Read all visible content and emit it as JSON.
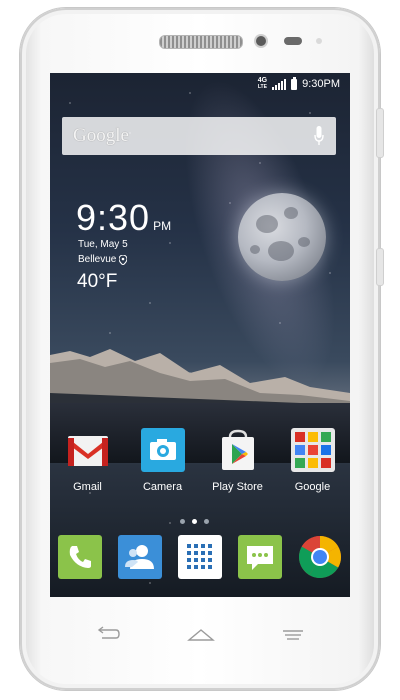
{
  "statusbar": {
    "network": "4G",
    "network_sub": "LTE",
    "time": "9:30PM"
  },
  "search": {
    "logo": "Google",
    "mic_icon": "mic-icon"
  },
  "clock": {
    "time": "9:30",
    "ampm": "PM",
    "date": "Tue, May 5",
    "location": "Bellevue",
    "temperature": "40°F"
  },
  "apps": [
    {
      "label": "Gmail",
      "icon": "gmail-icon"
    },
    {
      "label": "Camera",
      "icon": "camera-icon"
    },
    {
      "label": "Play Store",
      "icon": "play-store-icon"
    },
    {
      "label": "Google",
      "icon": "google-folder-icon"
    }
  ],
  "page_indicator": {
    "pages": 3,
    "current": 2
  },
  "dock": [
    {
      "icon": "phone-icon"
    },
    {
      "icon": "contacts-icon"
    },
    {
      "icon": "app-drawer-icon"
    },
    {
      "icon": "messaging-icon"
    },
    {
      "icon": "chrome-icon"
    }
  ],
  "navbar": [
    {
      "icon": "back-icon"
    },
    {
      "icon": "home-icon"
    },
    {
      "icon": "menu-icon"
    }
  ],
  "colors": {
    "phone_green": "#8bc34a",
    "camera_blue": "#29a9e0",
    "contacts_blue": "#3b8fd8",
    "gmail_red": "#d93025"
  }
}
